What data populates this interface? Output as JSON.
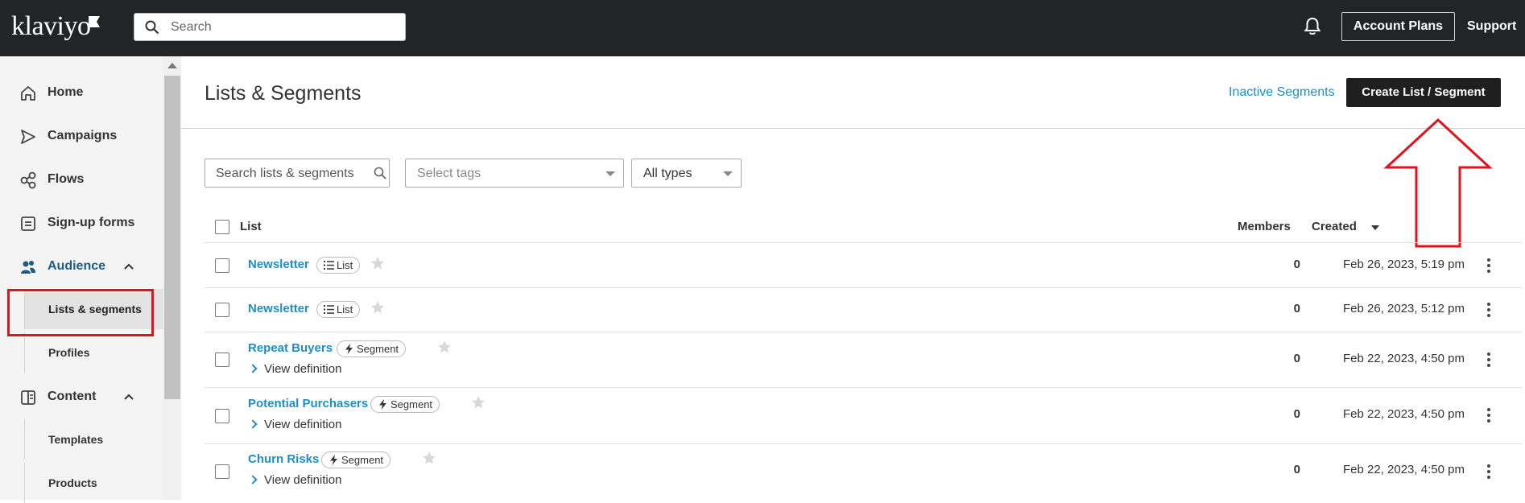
{
  "app": {
    "logo_text": "klaviyo",
    "search_placeholder": "Search",
    "account_plans_label": "Account Plans",
    "support_label": "Support"
  },
  "sidebar": {
    "items": [
      {
        "label": "Home",
        "icon": "home-icon"
      },
      {
        "label": "Campaigns",
        "icon": "send-icon"
      },
      {
        "label": "Flows",
        "icon": "flows-icon"
      },
      {
        "label": "Sign-up forms",
        "icon": "form-icon"
      },
      {
        "label": "Audience",
        "icon": "people-icon",
        "expanded": true
      },
      {
        "label": "Lists & segments",
        "active": true
      },
      {
        "label": "Profiles"
      },
      {
        "label": "Content",
        "icon": "content-icon",
        "expanded": true
      },
      {
        "label": "Templates"
      },
      {
        "label": "Products"
      }
    ]
  },
  "main": {
    "title": "Lists & Segments",
    "inactive_link": "Inactive Segments",
    "create_button": "Create List / Segment",
    "filters": {
      "search_placeholder": "Search lists & segments",
      "tags_placeholder": "Select tags",
      "types_value": "All types"
    },
    "table": {
      "headers": {
        "list": "List",
        "members": "Members",
        "created": "Created"
      },
      "sort_column": "Created",
      "rows": [
        {
          "name": "Newsletter",
          "type": "List",
          "members": "0",
          "created": "Feb 26, 2023, 5:19 pm",
          "view_definition": ""
        },
        {
          "name": "Newsletter",
          "type": "List",
          "members": "0",
          "created": "Feb 26, 2023, 5:12 pm",
          "view_definition": ""
        },
        {
          "name": "Repeat Buyers",
          "type": "Segment",
          "members": "0",
          "created": "Feb 22, 2023, 4:50 pm",
          "view_definition": "View definition"
        },
        {
          "name": "Potential Purchasers",
          "type": "Segment",
          "members": "0",
          "created": "Feb 22, 2023, 4:50 pm",
          "view_definition": "View definition"
        },
        {
          "name": "Churn Risks",
          "type": "Segment",
          "members": "0",
          "created": "Feb 22, 2023, 4:50 pm",
          "view_definition": "View definition"
        }
      ]
    }
  },
  "colors": {
    "topbar": "#232426",
    "link_blue": "#1f8ec6",
    "annotation_red": "#e0141e",
    "primary_button": "#1f1f1f"
  }
}
